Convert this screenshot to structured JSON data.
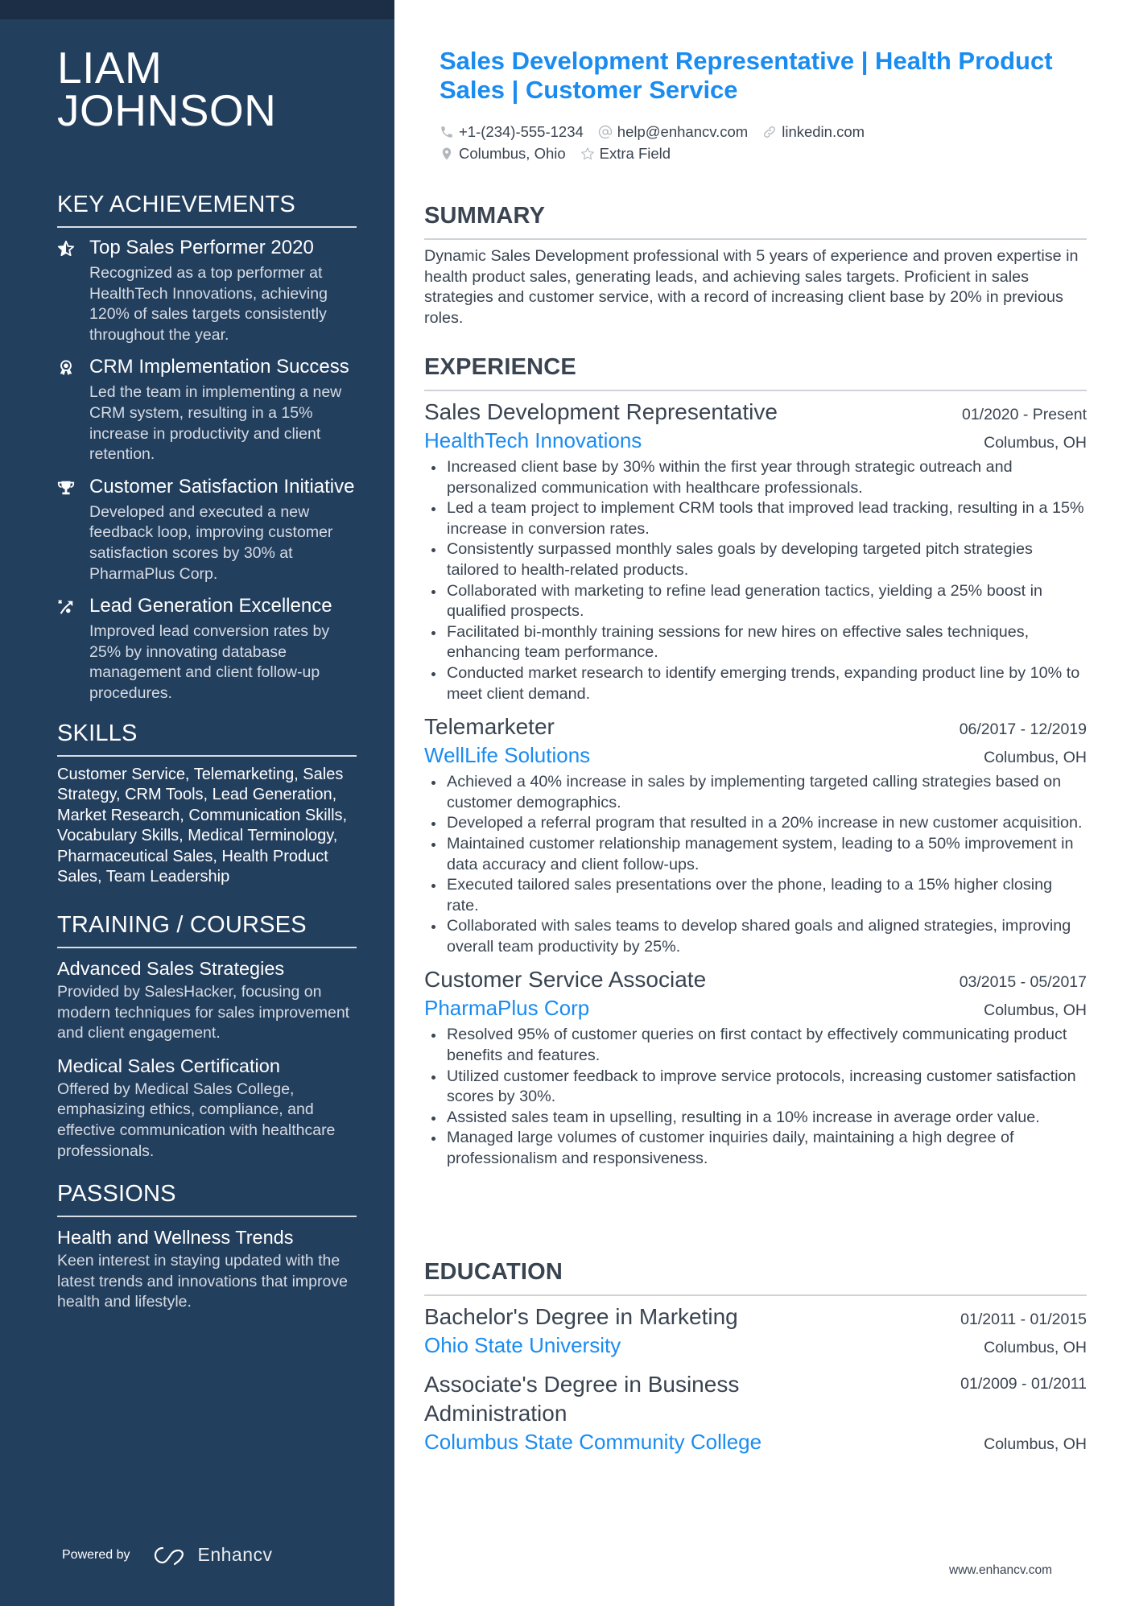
{
  "colors": {
    "sidebar_bg": "#233f5e",
    "sidebar_top_strip": "#1b2e45",
    "accent": "#1a8cf0",
    "text": "#3a4451"
  },
  "profile": {
    "first_name": "LIAM",
    "last_name": "JOHNSON",
    "headline": "Sales Development Representative | Health Product Sales | Customer Service"
  },
  "contacts": [
    {
      "icon": "phone-icon",
      "value": "+1-(234)-555-1234"
    },
    {
      "icon": "at-icon",
      "value": "help@enhancv.com"
    },
    {
      "icon": "link-icon",
      "value": "linkedin.com"
    },
    {
      "icon": "location-pin-icon",
      "value": "Columbus, Ohio"
    },
    {
      "icon": "star-outline-icon",
      "value": "Extra Field"
    }
  ],
  "sidebar": {
    "achievements": {
      "heading": "KEY ACHIEVEMENTS",
      "items": [
        {
          "icon": "star-half-icon",
          "title": "Top Sales Performer 2020",
          "description": "Recognized as a top performer at HealthTech Innovations, achieving 120% of sales targets consistently throughout the year."
        },
        {
          "icon": "award-ribbon-icon",
          "title": "CRM Implementation Success",
          "description": "Led the team in implementing a new CRM system, resulting in a 15% increase in productivity and client retention."
        },
        {
          "icon": "trophy-icon",
          "title": "Customer Satisfaction Initiative",
          "description": "Developed and executed a new feedback loop, improving customer satisfaction scores by 30% at PharmaPlus Corp."
        },
        {
          "icon": "strategy-arrow-icon",
          "title": "Lead Generation Excellence",
          "description": "Improved lead conversion rates by 25% by innovating database management and client follow-up procedures."
        }
      ]
    },
    "skills": {
      "heading": "SKILLS",
      "text": "Customer Service, Telemarketing, Sales Strategy, CRM Tools, Lead Generation, Market Research, Communication Skills, Vocabulary Skills, Medical Terminology, Pharmaceutical Sales, Health Product Sales, Team Leadership"
    },
    "training": {
      "heading": "TRAINING / COURSES",
      "items": [
        {
          "title": "Advanced Sales Strategies",
          "description": "Provided by SalesHacker, focusing on modern techniques for sales improvement and client engagement."
        },
        {
          "title": "Medical Sales Certification",
          "description": "Offered by Medical Sales College, emphasizing ethics, compliance, and effective communication with healthcare professionals."
        }
      ]
    },
    "passions": {
      "heading": "PASSIONS",
      "items": [
        {
          "title": "Health and Wellness Trends",
          "description": "Keen interest in staying updated with the latest trends and innovations that improve health and lifestyle."
        }
      ]
    },
    "powered_by": "Powered by",
    "brand": "Enhancv"
  },
  "summary": {
    "heading": "SUMMARY",
    "text": "Dynamic Sales Development professional with 5 years of experience and proven expertise in health product sales, generating leads, and achieving sales targets. Proficient in sales strategies and customer service, with a record of increasing client base by 20% in previous roles."
  },
  "experience": {
    "heading": "EXPERIENCE",
    "jobs": [
      {
        "title": "Sales Development Representative",
        "dates": "01/2020 - Present",
        "company": "HealthTech Innovations",
        "location": "Columbus, OH",
        "bullets": [
          "Increased client base by 30% within the first year through strategic outreach and personalized communication with healthcare professionals.",
          "Led a team project to implement CRM tools that improved lead tracking, resulting in a 15% increase in conversion rates.",
          "Consistently surpassed monthly sales goals by developing targeted pitch strategies tailored to health-related products.",
          "Collaborated with marketing to refine lead generation tactics, yielding a 25% boost in qualified prospects.",
          "Facilitated bi-monthly training sessions for new hires on effective sales techniques, enhancing team performance.",
          "Conducted market research to identify emerging trends, expanding product line by 10% to meet client demand."
        ]
      },
      {
        "title": "Telemarketer",
        "dates": "06/2017 - 12/2019",
        "company": "WellLife Solutions",
        "location": "Columbus, OH",
        "bullets": [
          "Achieved a 40% increase in sales by implementing targeted calling strategies based on customer demographics.",
          "Developed a referral program that resulted in a 20% increase in new customer acquisition.",
          "Maintained customer relationship management system, leading to a 50% improvement in data accuracy and client follow-ups.",
          "Executed tailored sales presentations over the phone, leading to a 15% higher closing rate.",
          "Collaborated with sales teams to develop shared goals and aligned strategies, improving overall team productivity by 25%."
        ]
      },
      {
        "title": "Customer Service Associate",
        "dates": "03/2015 - 05/2017",
        "company": "PharmaPlus Corp",
        "location": "Columbus, OH",
        "bullets": [
          "Resolved 95% of customer queries on first contact by effectively communicating product benefits and features.",
          "Utilized customer feedback to improve service protocols, increasing customer satisfaction scores by 30%.",
          "Assisted sales team in upselling, resulting in a 10% increase in average order value.",
          "Managed large volumes of customer inquiries daily, maintaining a high degree of professionalism and responsiveness."
        ]
      }
    ]
  },
  "education": {
    "heading": "EDUCATION",
    "items": [
      {
        "degree": "Bachelor's Degree in Marketing",
        "dates": "01/2011 - 01/2015",
        "school": "Ohio State University",
        "location": "Columbus, OH"
      },
      {
        "degree": "Associate's Degree in Business Administration",
        "dates": "01/2009 - 01/2011",
        "school": "Columbus State Community College",
        "location": "Columbus, OH"
      }
    ]
  },
  "footer": {
    "url": "www.enhancv.com"
  }
}
